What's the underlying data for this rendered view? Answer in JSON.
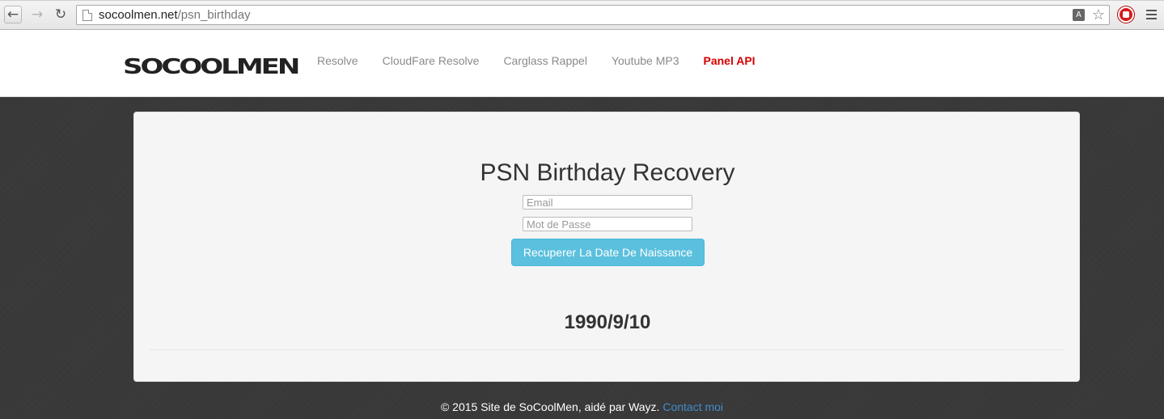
{
  "browser": {
    "url_host": "socoolmen.net",
    "url_path": "/psn_birthday",
    "back_icon": "←",
    "forward_icon": "→",
    "reload_icon": "↻",
    "translate_icon": "A",
    "star_icon": "☆"
  },
  "navbar": {
    "logo": "SOCOOLMEN",
    "links": [
      {
        "label": "Resolve"
      },
      {
        "label": "CloudFare Resolve"
      },
      {
        "label": "Carglass Rappel"
      },
      {
        "label": "Youtube MP3"
      },
      {
        "label": "Panel API"
      }
    ]
  },
  "form": {
    "title": "PSN Birthday Recovery",
    "email_placeholder": "Email",
    "password_placeholder": "Mot de Passe",
    "submit_label": "Recuperer La Date De Naissance",
    "result": "1990/9/10"
  },
  "footer": {
    "text": "© 2015 Site de SoCoolMen, aidé par Wayz.",
    "contact_label": "Contact moi"
  },
  "colors": {
    "active_link": "#d40000",
    "button": "#5bc0de",
    "contact_link": "#428bca"
  }
}
